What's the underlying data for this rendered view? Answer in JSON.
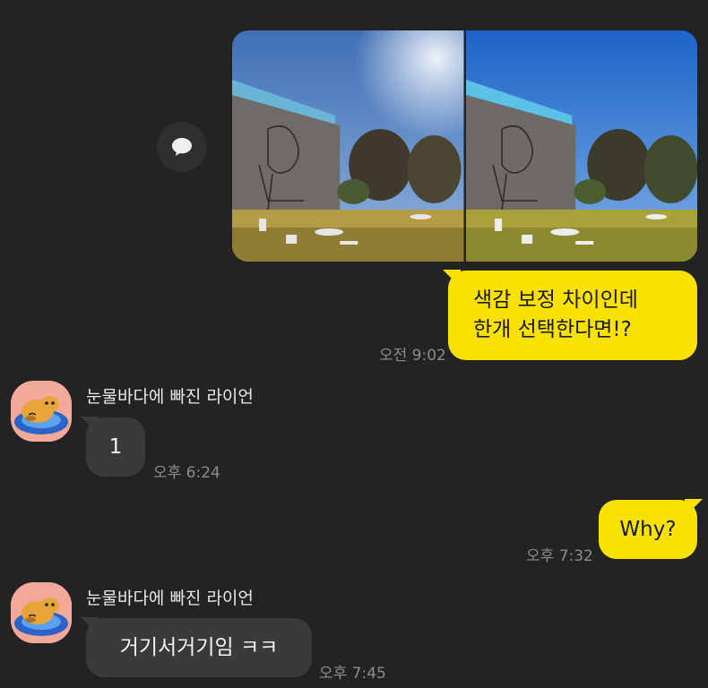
{
  "messages": {
    "outgoing_1": {
      "text": "색감 보정 차이인데\n한개 선택한다면!?",
      "time": "오전 9:02"
    },
    "incoming_1": {
      "sender": "눈물바다에 빠진 라이언",
      "text": "1",
      "time": "오후 6:24"
    },
    "outgoing_2": {
      "text": "Why?",
      "time": "오후 7:32"
    },
    "incoming_2": {
      "sender": "눈물바다에 빠진 라이언",
      "text": "거기서거기임 ㅋㅋ",
      "time": "오후 7:45"
    }
  },
  "icons": {
    "share": "speech-bubble-icon",
    "avatar": "ryan-lion-avatar"
  },
  "colors": {
    "background": "#232323",
    "my_bubble": "#fae100",
    "their_bubble": "#3a3a3a",
    "time_text": "#8c8c8c"
  }
}
